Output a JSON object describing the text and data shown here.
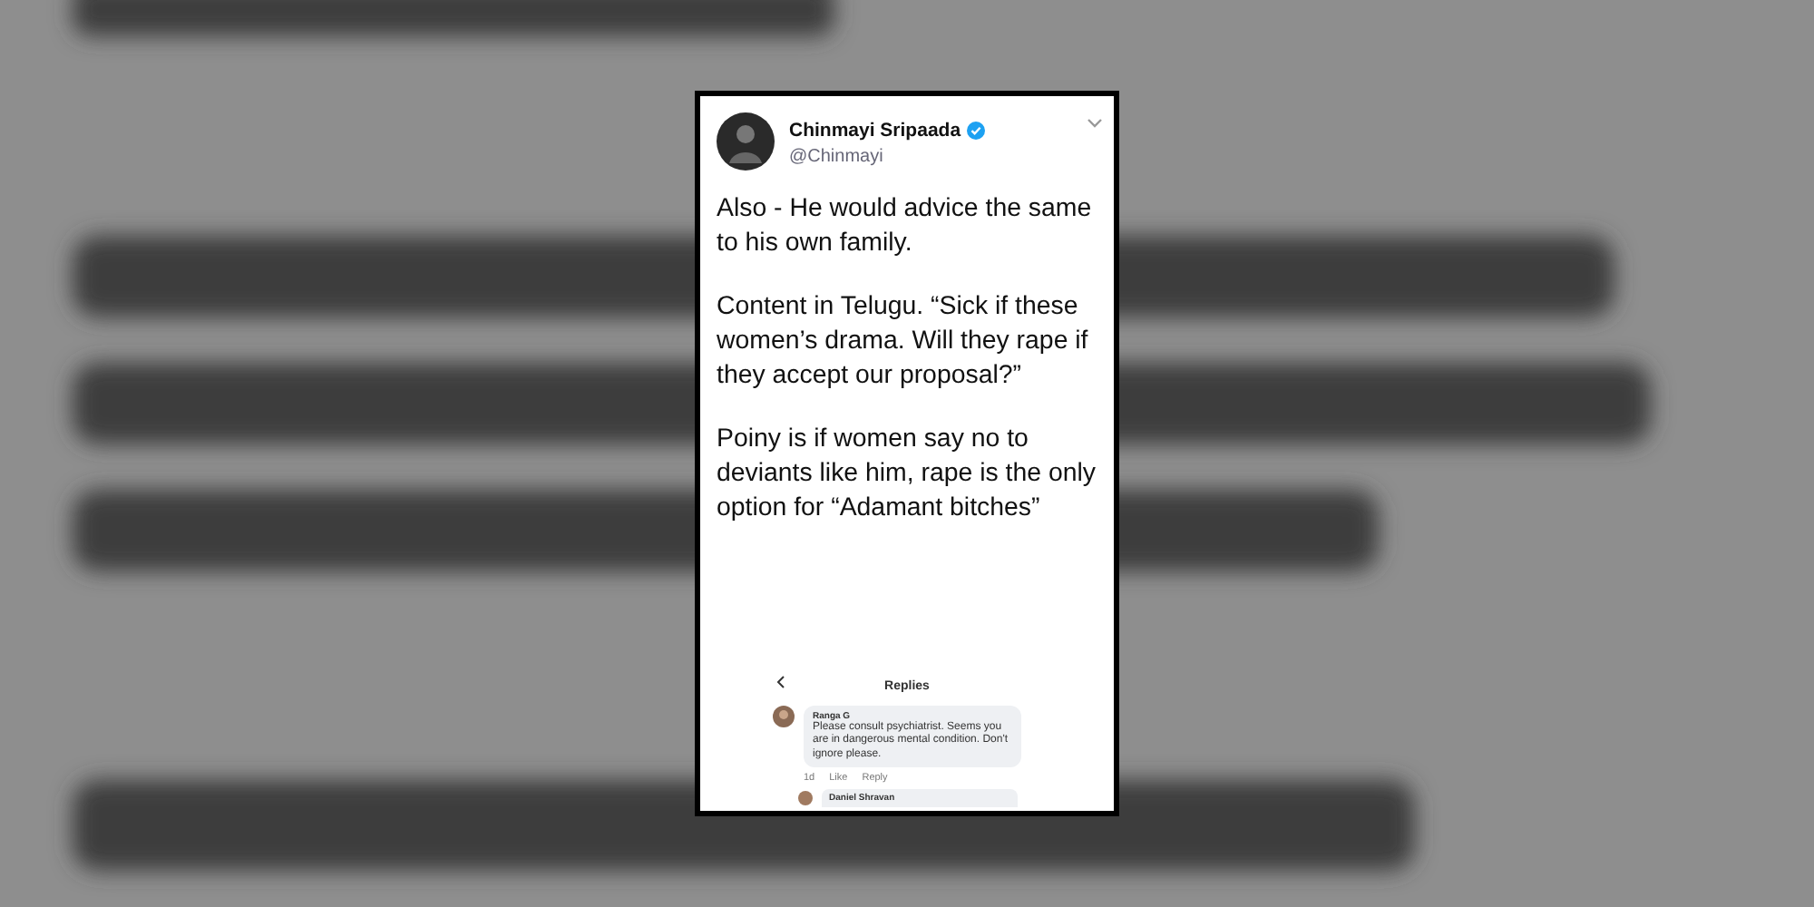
{
  "tweet": {
    "author": "Chinmayi Sripaada",
    "verified": true,
    "handle": "@Chinmayi",
    "paragraphs": [
      "Also - He would advice the same to his own family.",
      "Content in Telugu. “Sick if these women’s drama. Will they rape if they accept our proposal?”",
      "Poiny is if women say no to deviants like him, rape is the only option for “Adamant bitches”"
    ],
    "attachment": {
      "title": "Replies",
      "comments": [
        {
          "author": "Ranga G",
          "text": "Please consult psychiatrist. Seems you are in dangerous mental condition. Don't ignore please.",
          "time": "1d",
          "actions": [
            "Like",
            "Reply"
          ]
        },
        {
          "author": "Daniel Shravan"
        }
      ]
    }
  }
}
